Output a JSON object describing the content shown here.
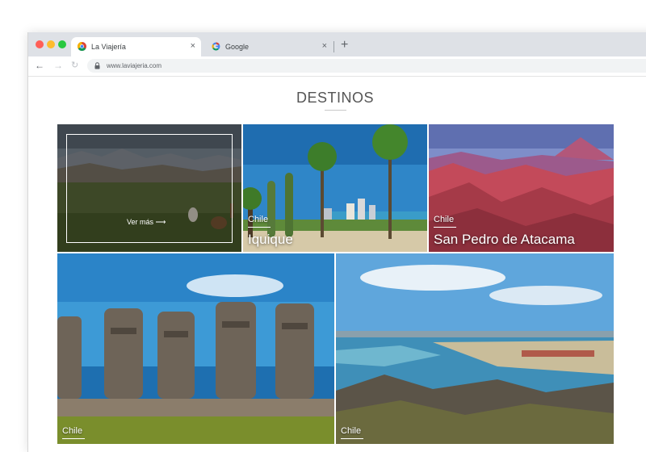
{
  "browser": {
    "tabs": [
      {
        "title": "La Viajería",
        "favicon": "chrome-icon",
        "active": true
      },
      {
        "title": "Google",
        "favicon": "google-icon",
        "active": false
      }
    ],
    "close_glyph": "×",
    "new_tab_glyph": "+",
    "url": "www.laviajeria.com"
  },
  "page": {
    "heading": "DESTINOS",
    "destinations": [
      {
        "country": "",
        "city": "",
        "hover_label": "Ver más",
        "scene": "altiplano-llamas"
      },
      {
        "country": "Chile",
        "city": "Iquique",
        "scene": "iquique-beach-palms"
      },
      {
        "country": "Chile",
        "city": "San Pedro de Atacama",
        "scene": "atacama-red-valley"
      },
      {
        "country": "Chile",
        "city": "",
        "scene": "easter-island-moai"
      },
      {
        "country": "Chile",
        "city": "",
        "scene": "rocky-coast"
      }
    ]
  },
  "colors": {
    "tab_strip": "#dee1e6",
    "heading": "#555555",
    "text_on_image": "#ffffff"
  }
}
